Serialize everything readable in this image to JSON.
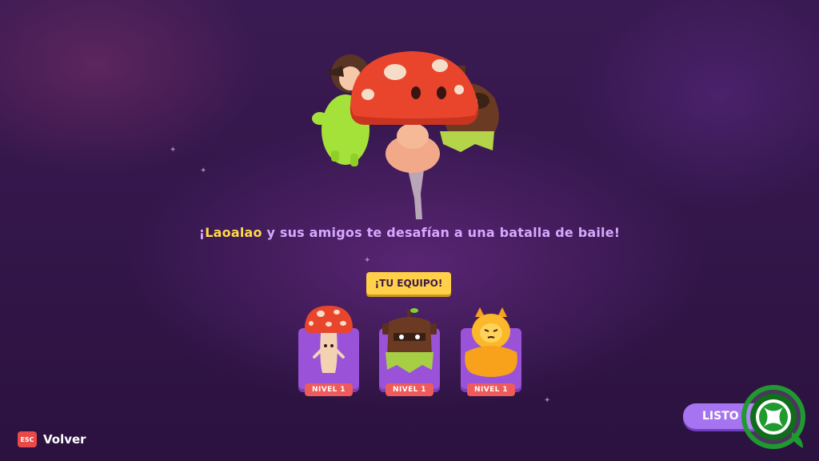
{
  "headline": {
    "opener": "¡",
    "name": "Laoalao",
    "rest": " y sus amigos te desafían a una batalla de baile!"
  },
  "team_badge": "¡TU EQUIPO!",
  "team": [
    {
      "level": "NIVEL 1",
      "icon": "mushroom-character-icon"
    },
    {
      "level": "NIVEL 1",
      "icon": "wood-stump-character-icon"
    },
    {
      "level": "NIVEL 1",
      "icon": "yellow-cat-character-icon"
    }
  ],
  "controls": {
    "back_key": "ESC",
    "back_label": "Volver",
    "ready_label": "LISTO"
  },
  "colors": {
    "accent_yellow": "#ffd84a",
    "headline_purple": "#d7a7ff",
    "card_purple": "#9a52d8",
    "level_red": "#ef5a5a",
    "ready_purple": "#a674f0",
    "xbox_green": "#1e9a2e"
  }
}
